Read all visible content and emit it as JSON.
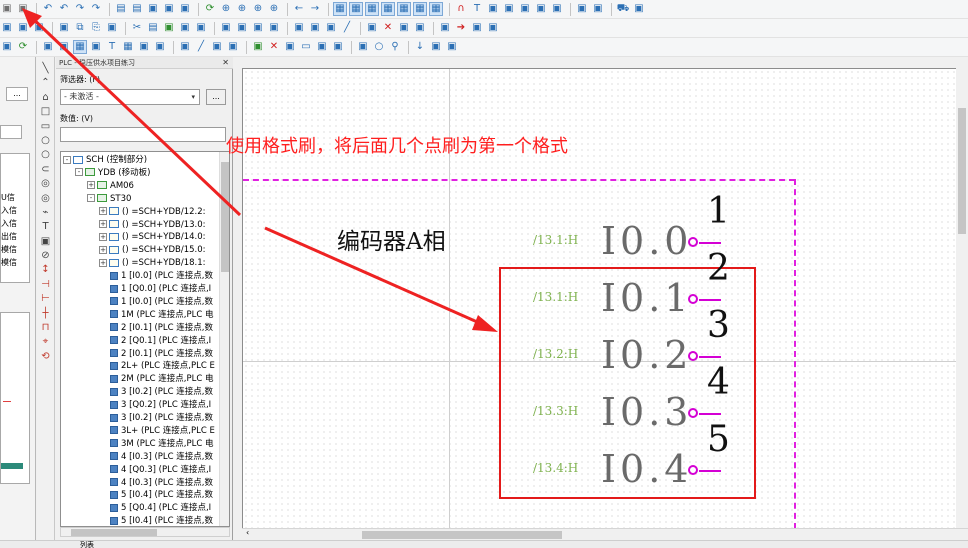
{
  "toolbar": {
    "row1_icons": [
      "brush-icon",
      "format-painter-icon",
      "undo-icon",
      "undo-all-icon",
      "redo-icon",
      "redo-all-icon",
      "page-view-icon",
      "page-list-icon",
      "print-preview-icon",
      "window-icon",
      "monitor-icon",
      "refresh-icon",
      "zoom-icon",
      "zoom-in-icon",
      "zoom-out-icon",
      "zoom-fit-icon",
      "back-icon",
      "forward-icon",
      "grid-a-icon",
      "grid-b-icon",
      "grid-c-icon",
      "grid-d-icon",
      "grid-e-icon",
      "grid-snap-icon",
      "grid-toggle-icon",
      "magnet-icon",
      "text-tool-icon",
      "snap-icon",
      "component-icon",
      "bar-icon",
      "layers-icon",
      "symbol-icon",
      "merge-icon",
      "expand-icon",
      "cart-icon",
      "measure-icon"
    ],
    "row2_icons": [
      "pointer-icon",
      "pen-icon",
      "flag-icon",
      "selection-icon",
      "copy-icon",
      "paste-icon",
      "open-icon",
      "cut-icon",
      "page-icon",
      "connect-icon",
      "device-icon",
      "terminal-icon",
      "cable-icon",
      "plug-icon",
      "output-icon",
      "input-icon",
      "move-icon",
      "align-icon",
      "fill-icon",
      "line-icon",
      "triangle-icon",
      "cross-icon",
      "split-icon",
      "node-icon",
      "link-icon",
      "arrow-icon",
      "branch-icon",
      "jump-icon"
    ],
    "row3_icons": [
      "route-icon",
      "refresh2-icon",
      "box-icon",
      "bus-icon",
      "grid2-icon",
      "cols-icon",
      "text2-icon",
      "table-icon",
      "frame-icon",
      "tree2-icon",
      "arc-icon",
      "line2-icon",
      "dash-icon",
      "graph-icon",
      "connect2-icon",
      "cross2-icon",
      "list2-icon",
      "rect2-icon",
      "shape-icon",
      "lshape-icon",
      "poly-icon",
      "circle2-icon",
      "pin-icon",
      "down-icon",
      "chart2-icon",
      "measure2-icon"
    ]
  },
  "left_panel": {
    "dropdown_button": "...",
    "row_labels": [
      "U信",
      "入信",
      "入信",
      "出信",
      "模信",
      "模信"
    ]
  },
  "navigator": {
    "title": "PLC - 稳压供水项目练习",
    "filter_label": "筛选器: (F)",
    "filter_value": "- 未激活 -",
    "filter_button": "...",
    "value_label": "数值: (V)",
    "value_input": ""
  },
  "tree": [
    {
      "indent": 0,
      "exp": "-",
      "icon": "sq",
      "text": "SCH (控制部分)"
    },
    {
      "indent": 1,
      "exp": "-",
      "icon": "grn",
      "text": "YDB (移动板)"
    },
    {
      "indent": 2,
      "exp": "+",
      "icon": "grn",
      "text": "AM06"
    },
    {
      "indent": 2,
      "exp": "-",
      "icon": "grn",
      "text": "ST30"
    },
    {
      "indent": 3,
      "exp": "+",
      "icon": "fn",
      "text": "() =SCH+YDB/12.2:"
    },
    {
      "indent": 3,
      "exp": "+",
      "icon": "fn",
      "text": "() =SCH+YDB/13.0:"
    },
    {
      "indent": 3,
      "exp": "+",
      "icon": "fn",
      "text": "() =SCH+YDB/14.0:"
    },
    {
      "indent": 3,
      "exp": "+",
      "icon": "fn",
      "text": "() =SCH+YDB/15.0:"
    },
    {
      "indent": 3,
      "exp": "+",
      "icon": "fn",
      "text": "() =SCH+YDB/18.1:"
    },
    {
      "indent": 3,
      "exp": "",
      "icon": "pt",
      "text": "1 [I0.0] (PLC 连接点,数"
    },
    {
      "indent": 3,
      "exp": "",
      "icon": "pt",
      "text": "1 [Q0.0] (PLC 连接点,I"
    },
    {
      "indent": 3,
      "exp": "",
      "icon": "pt",
      "text": "1 [I0.0] (PLC 连接点,数"
    },
    {
      "indent": 3,
      "exp": "",
      "icon": "pt",
      "text": "1M (PLC 连接点,PLC 电"
    },
    {
      "indent": 3,
      "exp": "",
      "icon": "pt",
      "text": "2 [I0.1] (PLC 连接点,数"
    },
    {
      "indent": 3,
      "exp": "",
      "icon": "pt",
      "text": "2 [Q0.1] (PLC 连接点,I"
    },
    {
      "indent": 3,
      "exp": "",
      "icon": "pt",
      "text": "2 [I0.1] (PLC 连接点,数"
    },
    {
      "indent": 3,
      "exp": "",
      "icon": "pt",
      "text": "2L+ (PLC 连接点,PLC E"
    },
    {
      "indent": 3,
      "exp": "",
      "icon": "pt",
      "text": "2M (PLC 连接点,PLC 电"
    },
    {
      "indent": 3,
      "exp": "",
      "icon": "pt",
      "text": "3 [I0.2] (PLC 连接点,数"
    },
    {
      "indent": 3,
      "exp": "",
      "icon": "pt",
      "text": "3 [Q0.2] (PLC 连接点,I"
    },
    {
      "indent": 3,
      "exp": "",
      "icon": "pt",
      "text": "3 [I0.2] (PLC 连接点,数"
    },
    {
      "indent": 3,
      "exp": "",
      "icon": "pt",
      "text": "3L+ (PLC 连接点,PLC E"
    },
    {
      "indent": 3,
      "exp": "",
      "icon": "pt",
      "text": "3M (PLC 连接点,PLC 电"
    },
    {
      "indent": 3,
      "exp": "",
      "icon": "pt",
      "text": "4 [I0.3] (PLC 连接点,数"
    },
    {
      "indent": 3,
      "exp": "",
      "icon": "pt",
      "text": "4 [Q0.3] (PLC 连接点,I"
    },
    {
      "indent": 3,
      "exp": "",
      "icon": "pt",
      "text": "4 [I0.3] (PLC 连接点,数"
    },
    {
      "indent": 3,
      "exp": "",
      "icon": "pt",
      "text": "5 [I0.4] (PLC 连接点,数"
    },
    {
      "indent": 3,
      "exp": "",
      "icon": "pt",
      "text": "5 [Q0.4] (PLC 连接点,I"
    },
    {
      "indent": 3,
      "exp": "",
      "icon": "pt",
      "text": "5 [I0.4] (PLC 连接点,数"
    }
  ],
  "canvas": {
    "annotation": "使用格式刷，将后面几个点刷为第一个格式",
    "encoder_label": "编码器A相",
    "points": [
      {
        "ref": "/13.1:H",
        "addr": "I0.0",
        "num": "1"
      },
      {
        "ref": "/13.1:H",
        "addr": "I0.1",
        "num": "2"
      },
      {
        "ref": "/13.2:H",
        "addr": "I0.2",
        "num": "3"
      },
      {
        "ref": "/13.3:H",
        "addr": "I0.3",
        "num": "4"
      },
      {
        "ref": "/13.4:H",
        "addr": "I0.4",
        "num": "5"
      }
    ],
    "colors": {
      "annotation": "#ff1f1f",
      "reference": "#7fb24f",
      "pin": "#d400d4",
      "frame": "#e31a1a",
      "border": "#e020e0"
    }
  },
  "status": {
    "tab_label": "列表"
  }
}
